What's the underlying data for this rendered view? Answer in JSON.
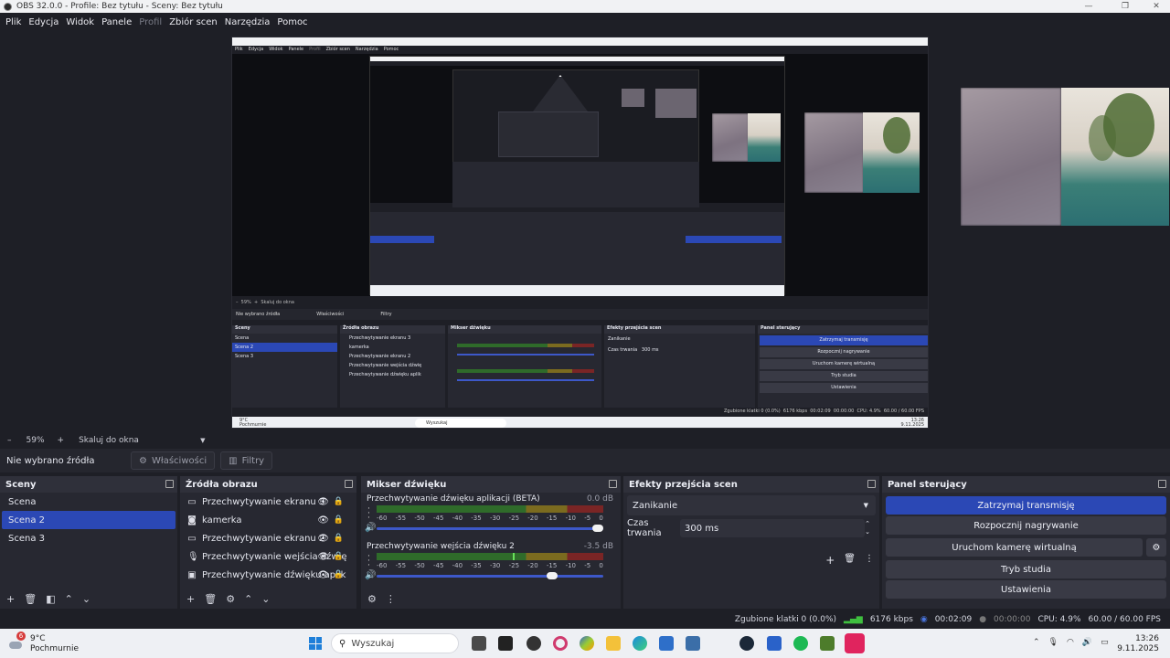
{
  "window": {
    "title": "OBS 32.0.0 - Profile: Bez tytułu - Sceny: Bez tytułu"
  },
  "menu": [
    "Plik",
    "Edycja",
    "Widok",
    "Panele",
    "Profil",
    "Zbiór scen",
    "Narzędzia",
    "Pomoc"
  ],
  "preview": {
    "zoom": "59%",
    "scale_option": "Skaluj do okna"
  },
  "source_toolbar": {
    "no_source": "Nie wybrano źródła",
    "properties": "Właściwości",
    "filters": "Filtry"
  },
  "scenes": {
    "title": "Sceny",
    "items": [
      "Scena",
      "Scena 2",
      "Scena 3"
    ],
    "active_index": 1
  },
  "sources": {
    "title": "Źródła obrazu",
    "items": [
      {
        "label": "Przechwytywanie ekranu 3",
        "icon": "monitor-icon"
      },
      {
        "label": "kamerka",
        "icon": "camera-icon"
      },
      {
        "label": "Przechwytywanie ekranu 2",
        "icon": "monitor-icon"
      },
      {
        "label": "Przechwytywanie wejścia dźwię",
        "icon": "microphone-icon"
      },
      {
        "label": "Przechwytywanie dźwięku aplik",
        "icon": "app-audio-icon"
      }
    ]
  },
  "mixer": {
    "title": "Mikser dźwięku",
    "scale": [
      "-60",
      "-55",
      "-50",
      "-45",
      "-40",
      "-35",
      "-30",
      "-25",
      "-20",
      "-15",
      "-10",
      "-5",
      "0"
    ],
    "channels": [
      {
        "name": "Przechwytywanie dźwięku aplikacji (BETA)",
        "db": "0.0 dB",
        "level": 0.0,
        "fader": 1.0
      },
      {
        "name": "Przechwytywanie wejścia dźwięku 2",
        "db": "-3.5 dB",
        "level": 0.6,
        "fader": 0.8
      }
    ]
  },
  "transitions": {
    "title": "Efekty przejścia scen",
    "selected": "Zanikanie",
    "duration_label": "Czas trwania",
    "duration_value": "300 ms"
  },
  "controls": {
    "title": "Panel sterujący",
    "stop_stream": "Zatrzymaj transmisję",
    "start_recording": "Rozpocznij nagrywanie",
    "virtual_camera": "Uruchom kamerę wirtualną",
    "studio_mode": "Tryb studia",
    "settings": "Ustawienia"
  },
  "status": {
    "dropped": "Zgubione klatki 0 (0.0%)",
    "bitrate": "6176 kbps",
    "stream_time": "00:02:09",
    "rec_time": "00:00:00",
    "cpu": "CPU: 4.9%",
    "fps": "60.00 / 60.00 FPS"
  },
  "taskbar": {
    "weather_temp": "9°C",
    "weather_desc": "Pochmurnie",
    "weather_badge": "6",
    "search": "Wyszukaj",
    "time": "13:26",
    "date": "9.11.2025"
  },
  "nested": {
    "menu": [
      "Plik",
      "Edycja",
      "Widok",
      "Panele",
      "Profil",
      "Zbiór scen",
      "Narzędzia",
      "Pomoc"
    ],
    "no_source": "Nie wybrano źródła",
    "properties": "Właściwości",
    "filters": "Filtry",
    "scene_title": "Sceny",
    "sources_title": "Źródła obrazu",
    "mixer_title": "Mikser dźwięku",
    "transitions_title": "Efekty przejścia scen",
    "controls_title": "Panel sterujący"
  },
  "colors": {
    "accent": "#2b48b5",
    "panel": "#272831",
    "bg": "#1e1f26"
  }
}
